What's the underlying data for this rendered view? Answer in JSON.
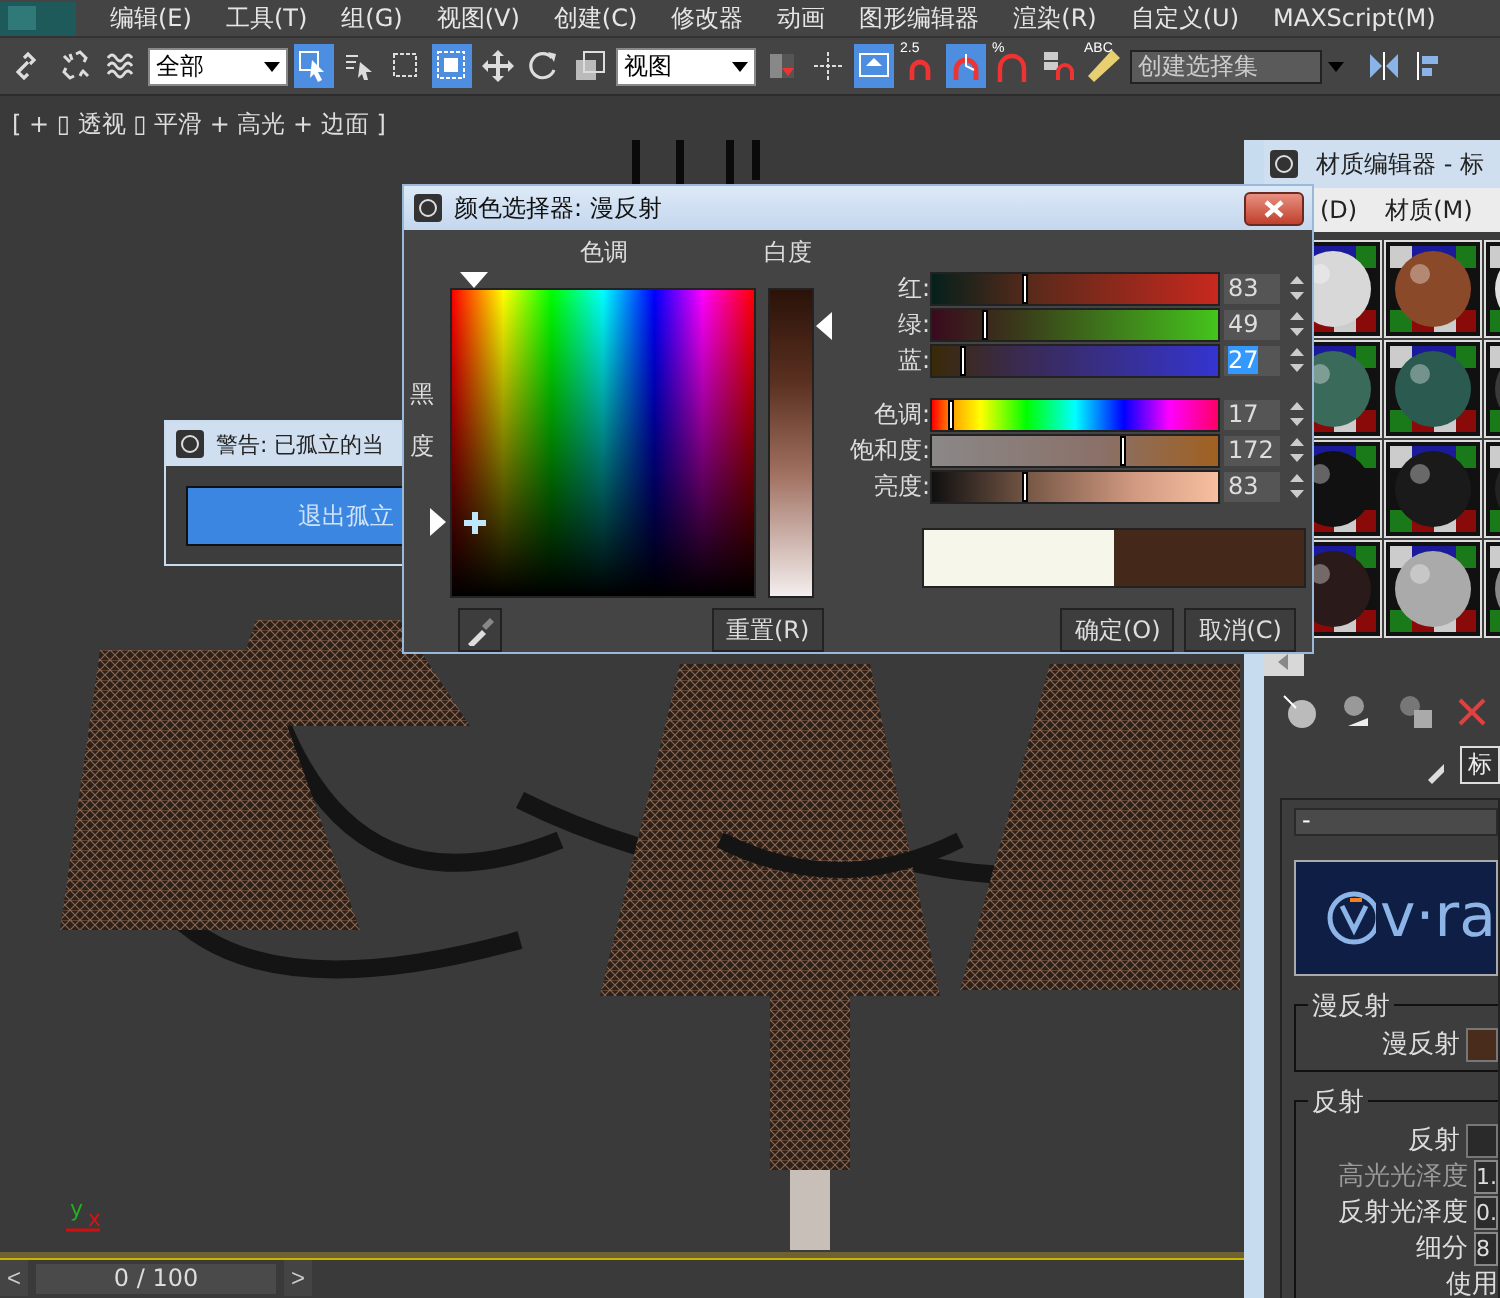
{
  "menu_bar": {
    "items": [
      "编辑(E)",
      "工具(T)",
      "组(G)",
      "视图(V)",
      "创建(C)",
      "修改器",
      "动画",
      "图形编辑器",
      "渲染(R)",
      "自定义(U)",
      "MAXScript(M)"
    ]
  },
  "toolbar": [
    {
      "kind": "button",
      "active": false
    },
    {
      "kind": "button",
      "active": false
    },
    {
      "kind": "button",
      "active": false
    },
    {
      "kind": "dropdown",
      "value": "全部"
    },
    {
      "kind": "button",
      "active": true
    },
    {
      "kind": "button",
      "active": false
    },
    {
      "kind": "button",
      "active": false
    },
    {
      "kind": "button",
      "active": true
    },
    {
      "kind": "button",
      "active": false
    },
    {
      "kind": "button",
      "active": false
    },
    {
      "kind": "button",
      "active": false
    },
    {
      "kind": "dropdown",
      "value": "视图"
    },
    {
      "kind": "button",
      "active": false
    },
    {
      "kind": "button",
      "active": false
    },
    {
      "kind": "button",
      "active": true
    },
    {
      "kind": "button",
      "active": false,
      "label": "2.5"
    },
    {
      "kind": "button",
      "active": true
    },
    {
      "kind": "button",
      "active": false,
      "label": "%"
    },
    {
      "kind": "button",
      "active": false
    },
    {
      "kind": "button",
      "active": false,
      "label": "ABC"
    },
    {
      "kind": "combo",
      "placeholder": "创建选择集"
    },
    {
      "kind": "button",
      "active": false
    },
    {
      "kind": "button",
      "active": false
    }
  ],
  "viewport": {
    "label": "[ + ▯ 透视 ▯ 平滑 + 高光 + 边面 ]",
    "axis_y": "y",
    "axis_x": "x"
  },
  "timeline": {
    "prev": "<",
    "frame": "0 / 100",
    "next": ">",
    "level": 0
  },
  "warning_dialog": {
    "title": "警告: 已孤立的当",
    "button": "退出孤立"
  },
  "material_editor": {
    "title": "材质编辑器 - 标",
    "menu": [
      "(D)",
      "材质(M)"
    ],
    "name_field": "标",
    "rollout_header": "-",
    "banner": "v·ra",
    "diffuse_group": {
      "title": "漫反射",
      "label": "漫反射",
      "color": "#4a2c1c"
    },
    "reflection_group": {
      "title": "反射",
      "rows": [
        {
          "kind": "swatch",
          "label": "反射",
          "color": "#2a2a2a",
          "disabled": false
        },
        {
          "kind": "value",
          "label": "高光光泽度",
          "value": "1.",
          "disabled": true
        },
        {
          "kind": "value",
          "label": "反射光泽度",
          "value": "0.",
          "disabled": false
        },
        {
          "kind": "value",
          "label": "细分",
          "value": "8",
          "disabled": false
        },
        {
          "kind": "text",
          "label": "使用",
          "disabled": false
        }
      ]
    }
  },
  "color_dialog": {
    "title": "颜色选择器: 漫反射",
    "hue_label": "色调",
    "whiteness_label": "白度",
    "blackness_label": "黑度",
    "hue": {
      "level": 0.07
    },
    "blackness": {
      "level": 0.76
    },
    "whiteness": {
      "level": 0.12
    },
    "channels": [
      {
        "kind": "red",
        "label": "红:",
        "value": "83",
        "level": 0.33,
        "selected": false
      },
      {
        "kind": "green",
        "label": "绿:",
        "value": "49",
        "level": 0.19,
        "selected": false
      },
      {
        "kind": "blue",
        "label": "蓝:",
        "value": "27",
        "level": 0.11,
        "selected": true
      },
      {
        "kind": "hue",
        "label": "色调:",
        "value": "17",
        "level": 0.07,
        "selected": false
      },
      {
        "kind": "saturation",
        "label": "饱和度:",
        "value": "172",
        "level": 0.67,
        "selected": false
      },
      {
        "kind": "brightness",
        "label": "亮度:",
        "value": "83",
        "level": 0.33,
        "selected": false
      }
    ],
    "swatches": [
      {
        "color": "#f6f6ea"
      },
      {
        "color": "#44281a"
      }
    ],
    "reset": "重置(R)",
    "ok": "确定(O)",
    "cancel": "取消(C)"
  }
}
